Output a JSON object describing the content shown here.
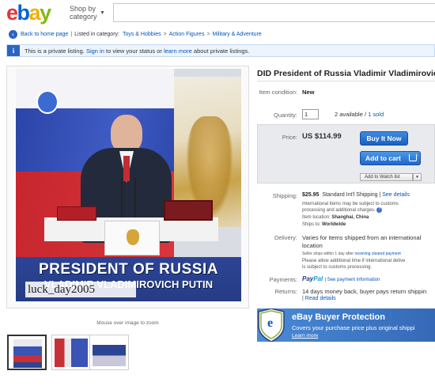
{
  "header": {
    "logo": [
      "e",
      "b",
      "a",
      "y"
    ],
    "shop_by_line1": "Shop by",
    "shop_by_line2": "category",
    "search_placeholder": ""
  },
  "breadcrumb": {
    "back": "Back to home page",
    "listed_in": "Listed in category:",
    "path": [
      "Toys & Hobbies",
      "Action Figures",
      "Military & Adventure"
    ]
  },
  "notice": {
    "prefix": "This is a private listing.",
    "signin": "Sign in",
    "middle": "to view your status or",
    "learn_more": "learn more",
    "suffix": "about private listings."
  },
  "image": {
    "watermark": "luck_day2005",
    "box_line1": "PRESIDENT OF RUSSIA",
    "box_line2": "VLADIMIR VLADIMIROVICH PUTIN",
    "zoom_hint": "Mouse over image to zoom"
  },
  "item": {
    "title": "DID President of Russia Vladimir Vladimirovich",
    "condition_label": "Item condition:",
    "condition_value": "New",
    "quantity_label": "Quantity:",
    "quantity_value": "1",
    "available": "2 available",
    "sold": "1 sold",
    "price_label": "Price:",
    "price": "US $114.99",
    "buy_now": "Buy It Now",
    "add_to_cart": "Add to cart",
    "watch": "Add to Watch list"
  },
  "shipping": {
    "label": "Shipping:",
    "cost": "$25.95",
    "service": "Standard Int'l Shipping",
    "details": "See details",
    "note1": "International items may be subject to customs",
    "note2": "processing and additional charges.",
    "location_label": "Item location:",
    "location": "Shanghai, China",
    "ships_to_label": "Ships to:",
    "ships_to": "Worldwide"
  },
  "delivery": {
    "label": "Delivery:",
    "line1": "Varies for items shipped from an international",
    "line2": "location",
    "seller_ships": "Seller ships within 1 day after",
    "cleared": "receiving cleared payment",
    "allow1": "Please allow additional time if international delive",
    "allow2": "is subject to customs processing."
  },
  "payments": {
    "label": "Payments:",
    "paypal_a": "Pay",
    "paypal_b": "Pal",
    "details": "See payment information"
  },
  "returns": {
    "label": "Returns:",
    "text": "14 days money back, buyer pays return shippin",
    "details": "Read details"
  },
  "protection": {
    "title": "eBay Buyer Protection",
    "subtitle": "Covers your purchase price plus original shippi",
    "learn": "Learn more"
  }
}
